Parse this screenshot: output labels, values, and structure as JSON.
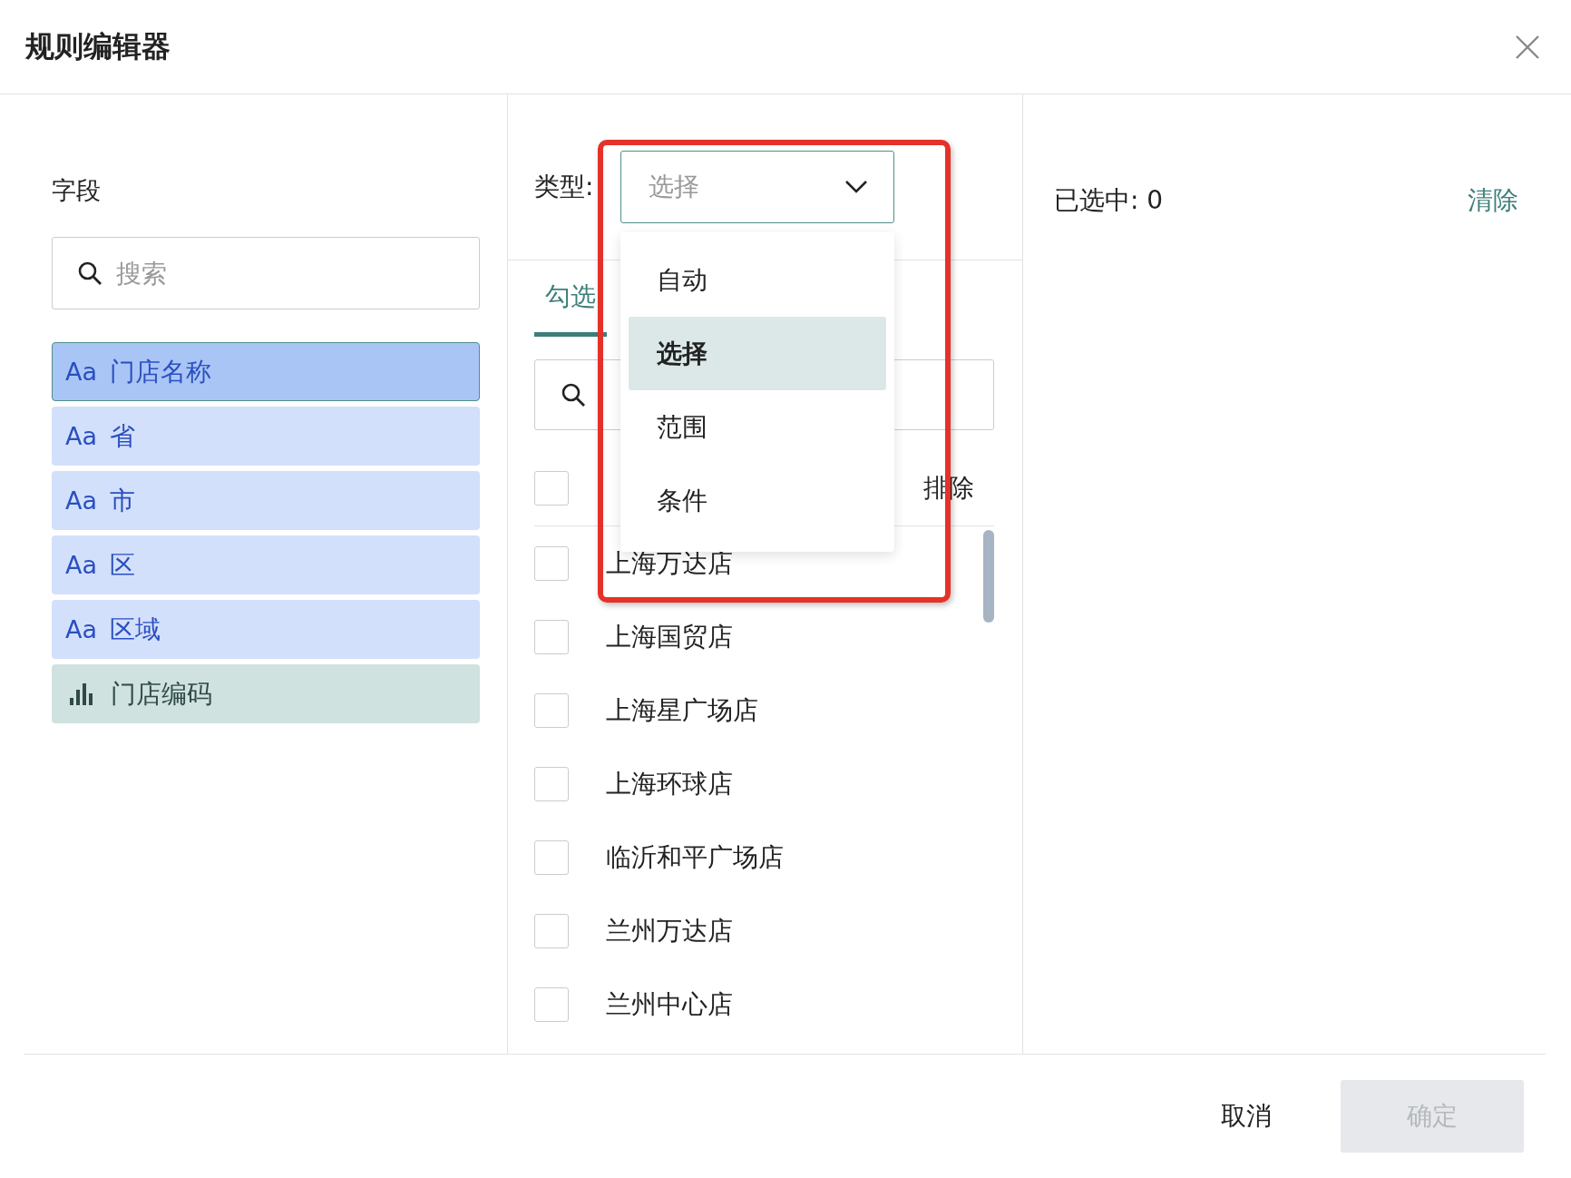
{
  "window": {
    "title": "规则编辑器"
  },
  "fields": {
    "label": "字段",
    "search": {
      "placeholder": "搜索"
    },
    "items": [
      {
        "kind": "text",
        "icon_text": "Aa",
        "name": "门店名称",
        "selected": true
      },
      {
        "kind": "text",
        "icon_text": "Aa",
        "name": "省",
        "selected": false
      },
      {
        "kind": "text",
        "icon_text": "Aa",
        "name": "市",
        "selected": false
      },
      {
        "kind": "text",
        "icon_text": "Aa",
        "name": "区",
        "selected": false
      },
      {
        "kind": "text",
        "icon_text": "Aa",
        "name": "区域",
        "selected": false
      },
      {
        "kind": "measure",
        "name": "门店编码",
        "selected": false
      }
    ]
  },
  "type_select": {
    "label": "类型:",
    "value": "选择",
    "expanded": true,
    "options": [
      {
        "label": "自动",
        "selected": false
      },
      {
        "label": "选择",
        "selected": true
      },
      {
        "label": "范围",
        "selected": false
      },
      {
        "label": "条件",
        "selected": false
      }
    ]
  },
  "tabs": [
    {
      "label": "勾选",
      "selected": true
    }
  ],
  "select_all": {
    "checked": false,
    "exclude_label": "排除"
  },
  "values": [
    {
      "label": "上海万达店",
      "checked": false
    },
    {
      "label": "上海国贸店",
      "checked": false
    },
    {
      "label": "上海星广场店",
      "checked": false
    },
    {
      "label": "上海环球店",
      "checked": false
    },
    {
      "label": "临沂和平广场店",
      "checked": false
    },
    {
      "label": "兰州万达店",
      "checked": false
    },
    {
      "label": "兰州中心店",
      "checked": false
    }
  ],
  "selected_summary": {
    "text": "已选中: 0",
    "clear": "清除"
  },
  "buttons": [
    {
      "label": "取消",
      "kind": "secondary",
      "disabled": false
    },
    {
      "label": "确定",
      "kind": "primary",
      "disabled": true
    }
  ]
}
